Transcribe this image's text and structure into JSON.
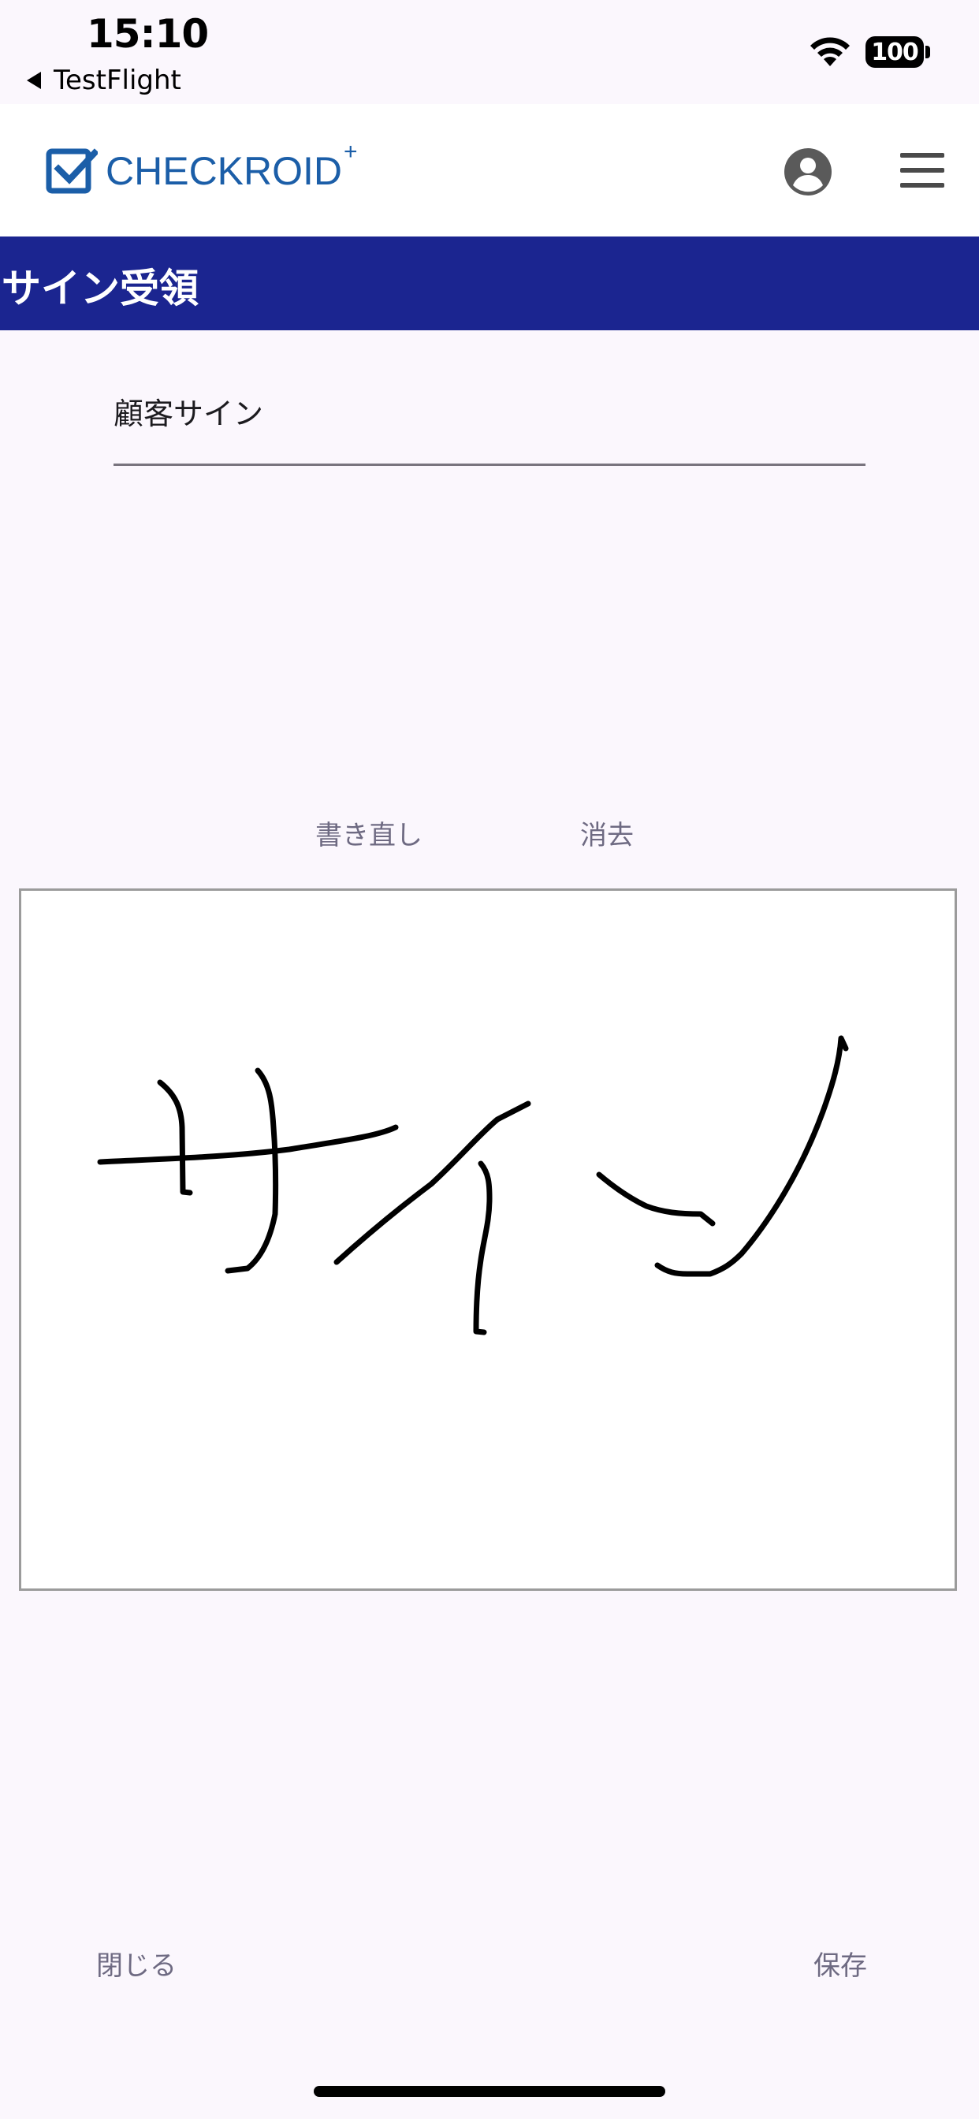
{
  "status_bar": {
    "time": "15:10",
    "back_label": "TestFlight",
    "battery": "100",
    "wifi_icon": "wifi-icon"
  },
  "header": {
    "logo_text": "CHECKROID",
    "logo_plus": "+",
    "brand_color": "#1b5ea8",
    "account_icon": "account-circle-icon",
    "menu_icon": "hamburger-menu-icon"
  },
  "title_bar": {
    "title": "サイン受領",
    "color": "#1b2590"
  },
  "form": {
    "customer_sign_label": "顧客サイン"
  },
  "actions": {
    "redo_label": "書き直し",
    "clear_label": "消去",
    "close_label": "閉じる",
    "save_label": "保存"
  }
}
